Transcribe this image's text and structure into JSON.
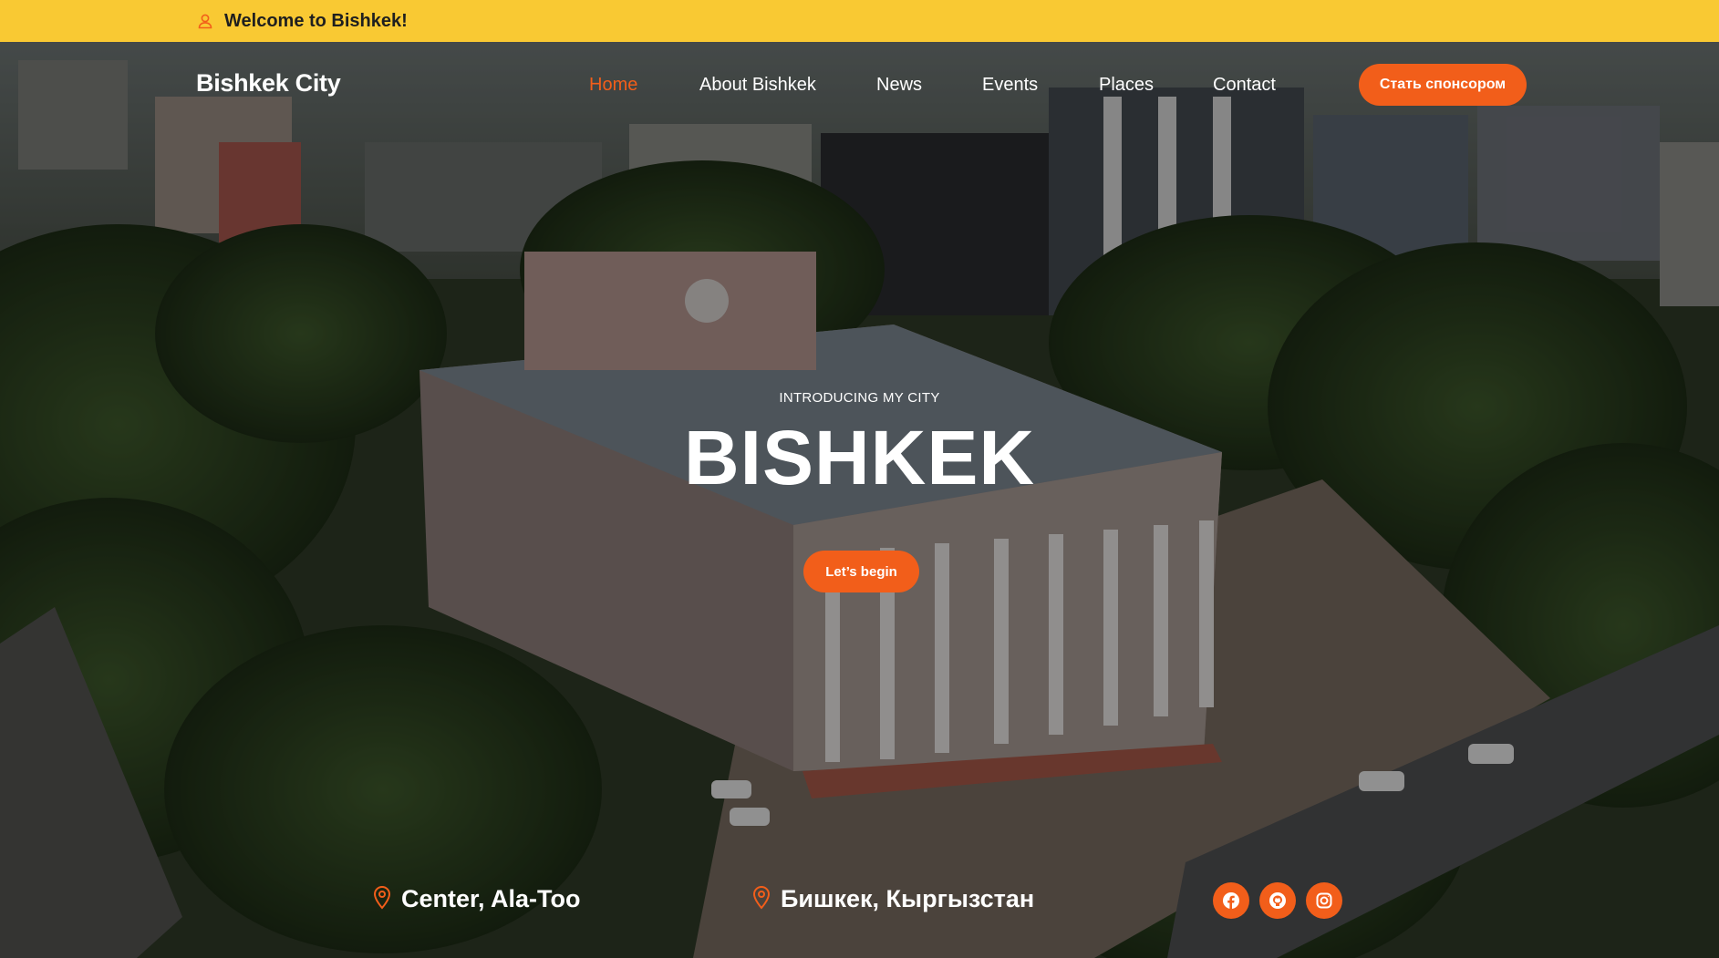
{
  "topbar": {
    "welcome": "Welcome to Bishkek!",
    "icon": "user-icon"
  },
  "nav": {
    "brand": "Bishkek City",
    "items": [
      {
        "label": "Home",
        "active": true
      },
      {
        "label": "About Bishkek"
      },
      {
        "label": "News"
      },
      {
        "label": "Events"
      },
      {
        "label": "Places"
      },
      {
        "label": "Contact"
      }
    ],
    "sponsor_label": "Стать спонсором"
  },
  "hero": {
    "eyebrow": "INTRODUCING MY CITY",
    "title": "BISHKEK",
    "cta_label": "Let’s begin"
  },
  "info": [
    {
      "icon": "map-pin-icon",
      "text": "Center, Ala-Too"
    },
    {
      "icon": "map-pin-icon",
      "text": "Бишкек, Кыргызстан"
    }
  ],
  "social": [
    {
      "icon": "facebook-icon"
    },
    {
      "icon": "github-icon"
    },
    {
      "icon": "instagram-icon"
    }
  ],
  "colors": {
    "topbar": "#F9C933",
    "accent": "#F25E1A",
    "text": "#FFFFFF"
  }
}
